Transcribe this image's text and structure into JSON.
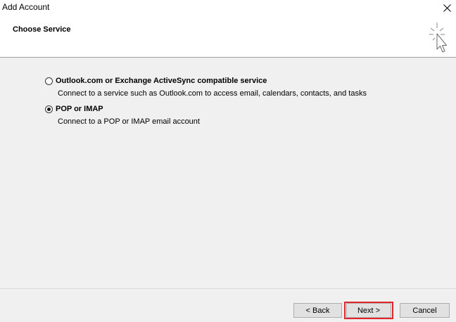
{
  "window": {
    "title": "Add Account",
    "close_icon": "close-icon"
  },
  "header": {
    "title": "Choose Service",
    "icon": "wizard-cursor-icon"
  },
  "options": [
    {
      "label": "Outlook.com or Exchange ActiveSync compatible service",
      "description": "Connect to a service such as Outlook.com to access email, calendars, contacts, and tasks",
      "selected": false
    },
    {
      "label": "POP or IMAP",
      "description": "Connect to a POP or IMAP email account",
      "selected": true
    }
  ],
  "footer": {
    "back_label": "< Back",
    "next_label": "Next >",
    "cancel_label": "Cancel",
    "highlight_color": "#e3262b"
  }
}
